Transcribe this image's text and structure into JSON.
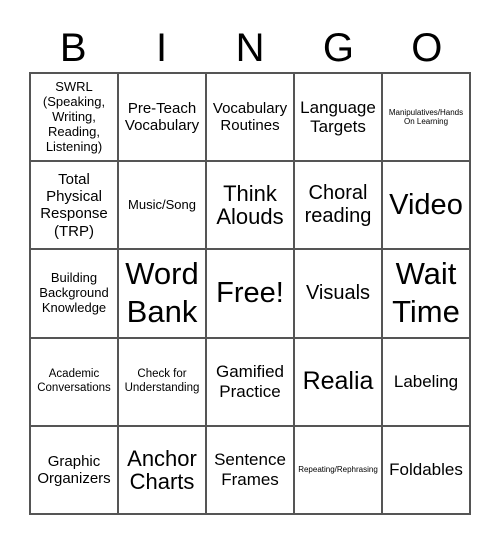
{
  "header": {
    "letters": [
      "B",
      "I",
      "N",
      "G",
      "O"
    ]
  },
  "cells": [
    [
      "SWRL (Speaking, Writing, Reading, Listening)",
      "Pre-Teach Vocabulary",
      "Vocabulary Routines",
      "Language Targets",
      "Manipulatives/Hands On Learning"
    ],
    [
      "Total Physical Response (TRP)",
      "Music/Song",
      "Think Alouds",
      "Choral reading",
      "Video"
    ],
    [
      "Building Background Knowledge",
      "Word Bank",
      "Free!",
      "Visuals",
      "Wait Time"
    ],
    [
      "Academic Conversations",
      "Check for Understanding",
      "Gamified Practice",
      "Realia",
      "Labeling"
    ],
    [
      "Graphic Organizers",
      "Anchor Charts",
      "Sentence Frames",
      "Repeating/Rephrasing",
      "Foldables"
    ]
  ]
}
